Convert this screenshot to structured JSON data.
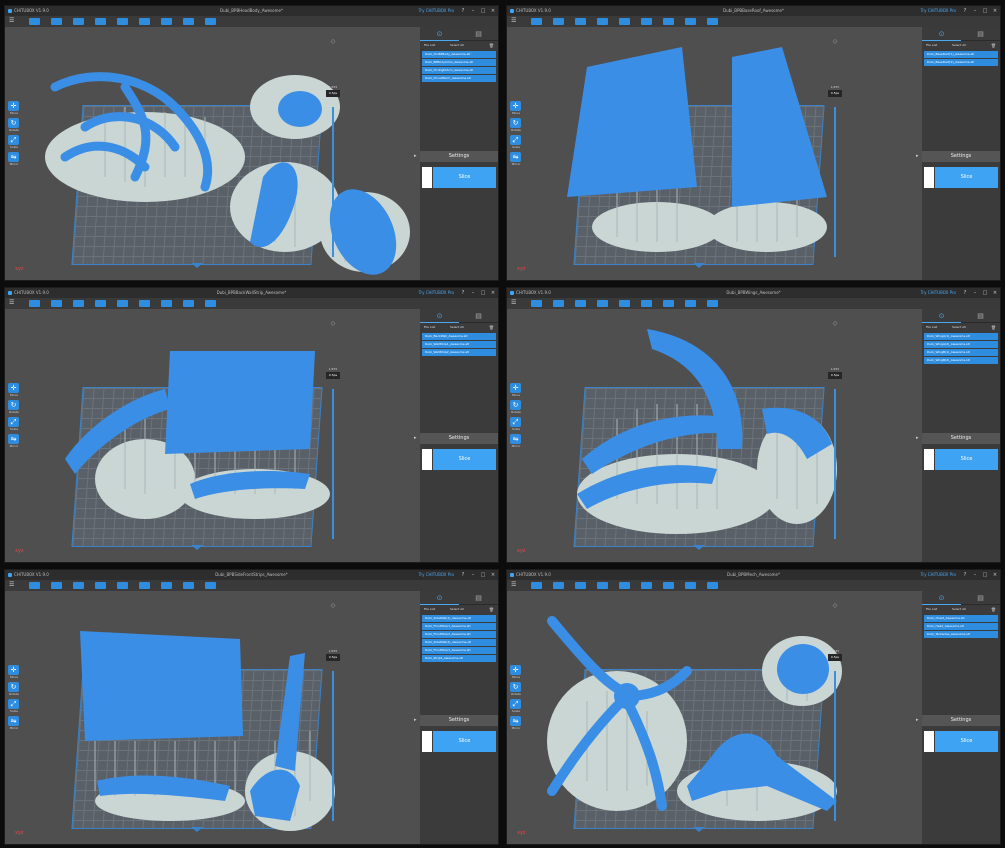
{
  "app": {
    "name": "CHITUBOX V1.9.0",
    "account": "Try CHITUBOX Pro"
  },
  "window_buttons": [
    "?",
    "–",
    "□",
    "×"
  ],
  "icons": {
    "menu": "☰",
    "move": "✛",
    "rotate": "↻",
    "scale": "⤢",
    "mirror": "⇋",
    "delete": "🗑",
    "axis": "xyz"
  },
  "tools": {
    "move": "Move",
    "rotate": "Rotate",
    "scale": "Scale",
    "mirror": "Mirror"
  },
  "layer_top": "1/455",
  "layer_btn": "0.5ps",
  "panel": {
    "file_list": "File List",
    "select_all": "Select All",
    "settings": "Settings",
    "slice": "Slice"
  },
  "colors": {
    "accent": "#3fa3f4",
    "model": "#3a8ee6",
    "support": "#a9b8b8",
    "raft": "#c9d6d4",
    "plate": "#5a6068"
  },
  "windows": [
    {
      "title": "Dubi_BPBHeadBody_Awesome*",
      "files": [
        "Dubi_Ch-BPBody_Awesome.stl",
        "Dubi_BPBodyArms_Awesome.stl",
        "Dubi_Ch-RightArm_Awesome.stl",
        "Dubi_Ch-LeftArm_Awesome.stl"
      ]
    },
    {
      "title": "Dubi_BPBBaseRoof_Awesome*",
      "files": [
        "Dubi_BaseRoof(1)_Awesome.stl",
        "Dubi_BaseRoof(2)_Awesome.stl"
      ]
    },
    {
      "title": "Dubi_BPBBackWallStrip_Awesome*",
      "files": [
        "Dubi_BackWall_Awesome.stl",
        "Dubi_WallStrip1_Awesome.stl",
        "Dubi_WallStrip2_Awesome.stl"
      ]
    },
    {
      "title": "Dubi_BPBWings_Awesome*",
      "files": [
        "Dubi_WingA(1)_Awesome.stl",
        "Dubi_WingA(2)_Awesome.stl",
        "Dubi_WingB(1)_Awesome.stl",
        "Dubi_WingB(2)_Awesome.stl"
      ]
    },
    {
      "title": "Dubi_BPBSideFrontStrips_Awesome*",
      "files": [
        "Dubi_SideWall(1)_Awesome.stl",
        "Dubi_FrontStrip1_Awesome.stl",
        "Dubi_FrontStrip2_Awesome.stl",
        "Dubi_SideWall(2)_Awesome.stl",
        "Dubi_FrontStrip3_Awesome.stl",
        "Dubi_Strip4_Awesome.stl"
      ]
    },
    {
      "title": "Dubi_BPBMech_Awesome*",
      "files": [
        "Dubi_Chest_Awesome.stl",
        "Dubi_Head_Awesome.stl",
        "Dubi_Tentacles_Awesome.stl"
      ]
    }
  ]
}
